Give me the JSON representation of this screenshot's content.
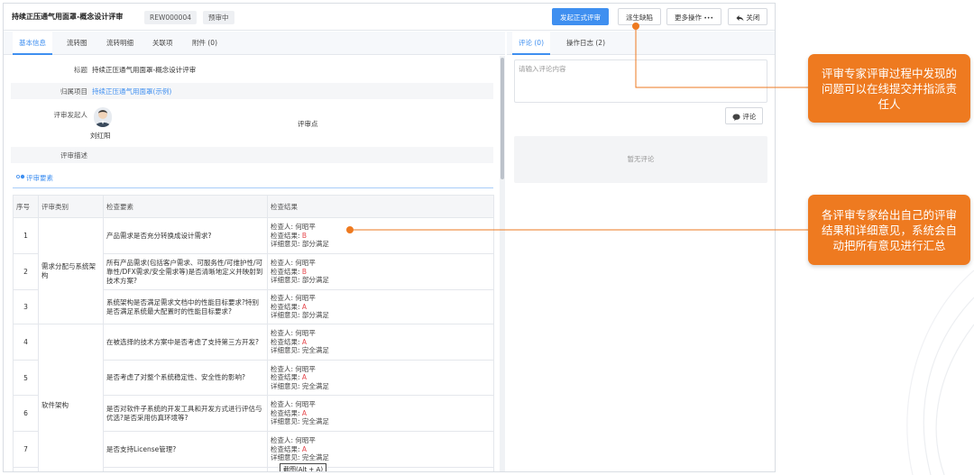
{
  "header": {
    "title": "持续正压通气用面罩-概念设计评审",
    "code": "REW000004",
    "status": "预审中",
    "buttons": {
      "start_review": "发起正式评审",
      "assign_defect": "派生缺陷",
      "more_actions": "更多操作",
      "more_dots": "•••",
      "close": "关闭"
    }
  },
  "left_tabs": [
    "基本信息",
    "流转图",
    "流转明细",
    "关联项",
    "附件 (0)"
  ],
  "fields": {
    "title_label": "标题",
    "title_value": "持续正压通气用面罩-概念设计评审",
    "project_label": "归属项目",
    "project_value": "持续正压通气用面罩(示例)",
    "initiator_label": "评审发起人",
    "initiator_name": "刘红阳",
    "review_point_label": "评审点",
    "description_label": "评审描述"
  },
  "section": {
    "title": "评审要素"
  },
  "table": {
    "headers": [
      "序号",
      "评审类别",
      "检查要素",
      "检查结果"
    ],
    "categories": [
      "需求分配与系统架构",
      "软件架构"
    ],
    "result_labels": {
      "checker": "检查人:",
      "result": "检查结果:",
      "opinion": "详细意见:"
    },
    "rows": [
      {
        "idx": "1",
        "requirement": "产品需求是否充分转换成设计需求?",
        "checker": "何昭平",
        "result": "B",
        "opinion": "部分满足"
      },
      {
        "idx": "2",
        "requirement": "所有产品需求(包括客户需求、可服务性/可维护性/可靠性/DFX需求/安全需求等)是否清晰地定义并映射到技术方案?",
        "checker": "何昭平",
        "result": "B",
        "opinion": "部分满足"
      },
      {
        "idx": "3",
        "requirement": "系统架构是否满足需求文档中的性能目标要求?特别是否满足系统最大配置时的性能目标要求?",
        "checker": "何昭平",
        "result": "A",
        "opinion": "部分满足"
      },
      {
        "idx": "4",
        "requirement": "在被选择的技术方案中是否考虑了支持第三方开发?",
        "checker": "何昭平",
        "result": "A",
        "opinion": "完全满足"
      },
      {
        "idx": "5",
        "requirement": "是否考虑了对整个系统稳定性、安全性的影响?",
        "checker": "何昭平",
        "result": "A",
        "opinion": "完全满足"
      },
      {
        "idx": "6",
        "requirement": "是否对软件子系统的开发工具和开发方式进行评估与优选?是否采用仿真环境等?",
        "checker": "何昭平",
        "result": "A",
        "opinion": "完全满足"
      },
      {
        "idx": "7",
        "requirement": "是否支持License管理?",
        "checker": "何昭平",
        "result": "A",
        "opinion": "完全满足"
      }
    ],
    "partial_row": {
      "checker": "何昭平"
    }
  },
  "tooltip": "截图(Alt + A)",
  "right_tabs": [
    "评论 (0)",
    "操作日志 (2)"
  ],
  "comment": {
    "placeholder": "请输入评论内容",
    "button": "评论",
    "empty": "暂无评论"
  },
  "callouts": [
    "评审专家评审过程中发现的问题可以在线提交并指派责任人",
    "各评审专家给出自己的评审结果和详细意见，系统会自动把所有意见进行汇总"
  ],
  "colors": {
    "accent": "#3f8ff0",
    "callout": "#ee7a20",
    "result_red": "#e5484d"
  },
  "icons": [
    "more-dots-icon",
    "reply-arrow-icon",
    "comment-bubble-icon",
    "section-dot-icon",
    "avatar-icon"
  ]
}
